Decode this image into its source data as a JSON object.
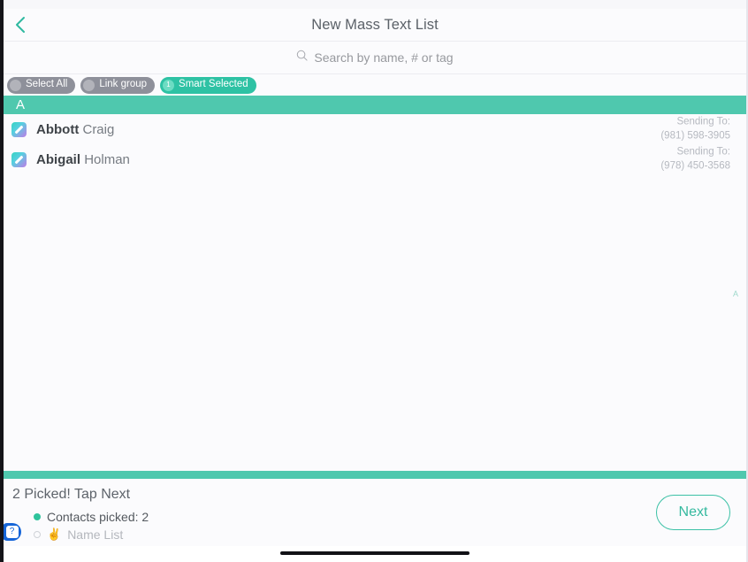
{
  "header": {
    "title": "New Mass Text List",
    "back_icon": "chevron-left-icon"
  },
  "search": {
    "icon": "search-icon",
    "placeholder": "Search by name, # or tag",
    "value": ""
  },
  "filter_chips": [
    {
      "label": "Select All",
      "badge": "",
      "style": "grey"
    },
    {
      "label": "Link group",
      "badge": "",
      "style": "grey"
    },
    {
      "label": "Smart Selected",
      "badge": "1",
      "style": "teal"
    }
  ],
  "section": {
    "letter": "A"
  },
  "contacts": [
    {
      "last_name": "Abbott",
      "first_name": "Craig",
      "selected": true,
      "sending_label": "Sending To:",
      "phone": "(981) 598-3905"
    },
    {
      "last_name": "Abigail",
      "first_name": "Holman",
      "selected": true,
      "sending_label": "Sending To:",
      "phone": "(978) 450-3568"
    }
  ],
  "alpha_index": [
    "A"
  ],
  "bottom": {
    "title": "2 Picked! Tap Next",
    "steps": [
      {
        "text": "Contacts picked: 2",
        "done": true,
        "emoji": ""
      },
      {
        "text": "Name List",
        "done": false,
        "emoji": "✌️"
      }
    ],
    "next_label": "Next",
    "help_label": "?"
  },
  "colors": {
    "teal": "#4fc8ae",
    "teal_dark": "#35b99f",
    "chip_grey": "#8e909a",
    "chip_teal": "#2ec2a4",
    "background": "#fbfbfd",
    "help_blue": "#1565d8"
  }
}
